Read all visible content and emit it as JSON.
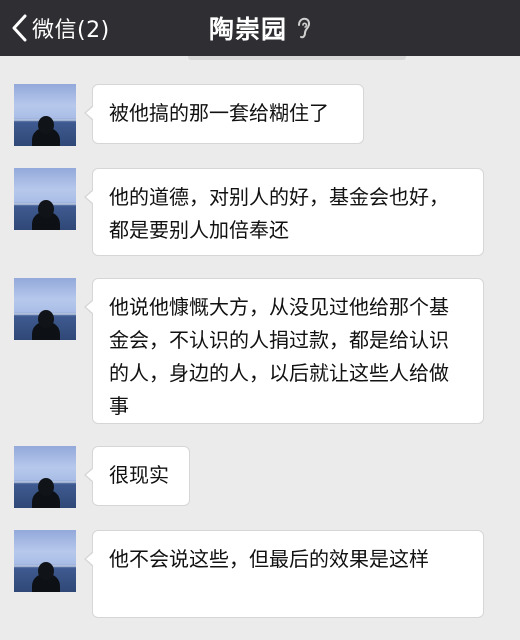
{
  "header": {
    "back_label": "微信(2)",
    "title": "陶崇园",
    "back_icon": "chevron-left-icon",
    "title_icon": "ear-icon",
    "background": "#2e2e33"
  },
  "chat": {
    "background": "#ebebeb",
    "bubble_color": "#ffffff",
    "messages": [
      {
        "text": "被他搞的那一套给糊住了"
      },
      {
        "text": "他的道德，对别人的好，基金会也好，都是要别人加倍奉还"
      },
      {
        "text": "他说他慷慨大方，从没见过他给那个基金会，不认识的人捐过款，都是给认识的人，身边的人，以后就让这些人给做事"
      },
      {
        "text": "很现实"
      },
      {
        "text": "他不会说这些，但最后的效果是这样"
      }
    ]
  }
}
